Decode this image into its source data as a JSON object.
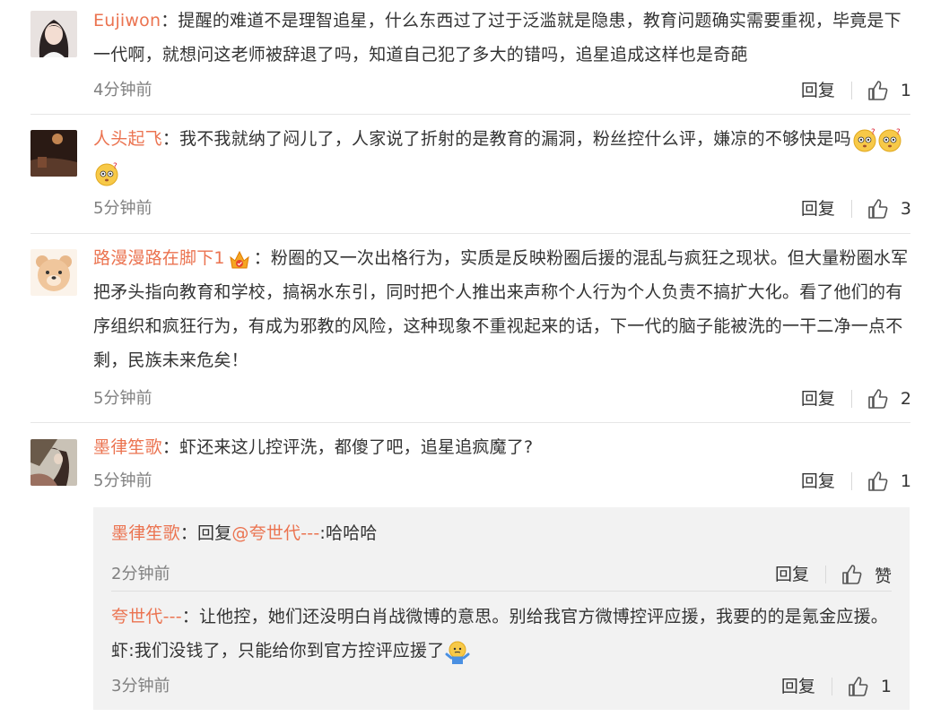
{
  "comments": [
    {
      "author": "Eujiwon",
      "text": "：提醒的难道不是理智追星，什么东西过了过于泛滥就是隐患，教育问题确实需要重视，毕竟是下一代啊，就想问这老师被辞退了吗，知道自己犯了多大的错吗，追星追成这样也是奇葩",
      "time": "4分钟前",
      "reply_label": "回复",
      "likes": "1",
      "avatar_icon": "girl-avatar"
    },
    {
      "author": "人头起飞",
      "text": "：我不我就纳了闷儿了，人家说了折射的是教育的漏洞，粉丝控什么评，嫌凉的不够快是吗",
      "emojis": [
        "confused-emoji",
        "confused-emoji",
        "confused-emoji"
      ],
      "time": "5分钟前",
      "reply_label": "回复",
      "likes": "3",
      "avatar_icon": "dark-room-avatar"
    },
    {
      "author": "路漫漫路在脚下1",
      "badge_icon": "fan-crown-badge",
      "text": "：粉圈的又一次出格行为，实质是反映粉圈后援的混乱与疯狂之现状。但大量粉圈水军把矛头指向教育和学校，搞祸水东引，同时把个人推出来声称个人行为个人负责不搞扩大化。看了他们的有序组织和疯狂行为，有成为邪教的风险，这种现象不重视起来的话，下一代的脑子能被洗的一干二净一点不剩，民族未来危矣！",
      "time": "5分钟前",
      "reply_label": "回复",
      "likes": "2",
      "avatar_icon": "bear-avatar"
    },
    {
      "author": "墨律笙歌",
      "text": "：虾还来这儿控评洗，都傻了吧，追星追疯魔了?",
      "time": "5分钟前",
      "reply_label": "回复",
      "likes": "1",
      "avatar_icon": "painting-avatar"
    }
  ],
  "replies": [
    {
      "author": "墨律笙歌",
      "prefix": "：回复",
      "mention": "@夸世代---",
      "text": ":哈哈哈",
      "time": "2分钟前",
      "reply_label": "回复",
      "likes": "赞"
    },
    {
      "author": "夸世代---",
      "text": "：让他控，她们还没明白肖战微博的意思。别给我官方微博控评应援，我要的的是氪金应援。虾:我们没钱了，只能给你到官方控评应援了",
      "emoji": "shrug-emoji",
      "time": "3分钟前",
      "reply_label": "回复",
      "likes": "1"
    }
  ],
  "colors": {
    "author": "#eb7350",
    "time": "#808080",
    "reply_bg": "#f2f2f2"
  }
}
